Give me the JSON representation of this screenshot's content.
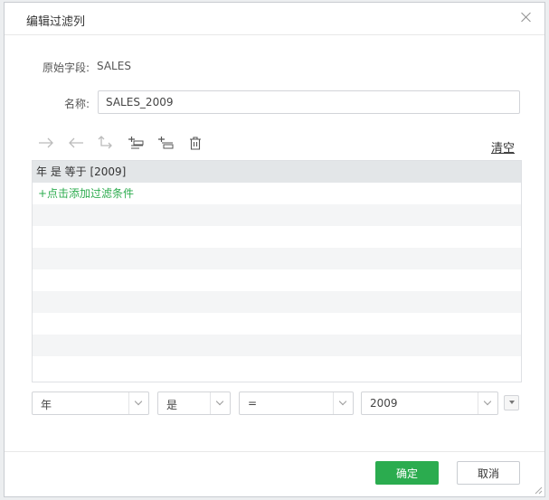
{
  "dialog": {
    "title": "编辑过滤列"
  },
  "fields": {
    "source_label": "原始字段:",
    "source_value": "SALES",
    "name_label": "名称:",
    "name_value": "SALES_2009"
  },
  "toolbar": {
    "clear_label": "清空",
    "buttons": [
      "indent-right-icon",
      "indent-left-icon",
      "wrap-icon",
      "insert-above-icon",
      "insert-below-icon",
      "delete-icon"
    ]
  },
  "conditions": {
    "items": [
      "年 是 等于 [2009]"
    ],
    "add_label": "+点击添加过滤条件"
  },
  "editor": {
    "field_value": "年",
    "operator_value": "是",
    "compare_value": "=",
    "value_value": "2009"
  },
  "footer": {
    "ok_label": "确定",
    "cancel_label": "取消"
  },
  "colors": {
    "accent": "#2bac4f",
    "selected_row": "#e3e6e8"
  }
}
